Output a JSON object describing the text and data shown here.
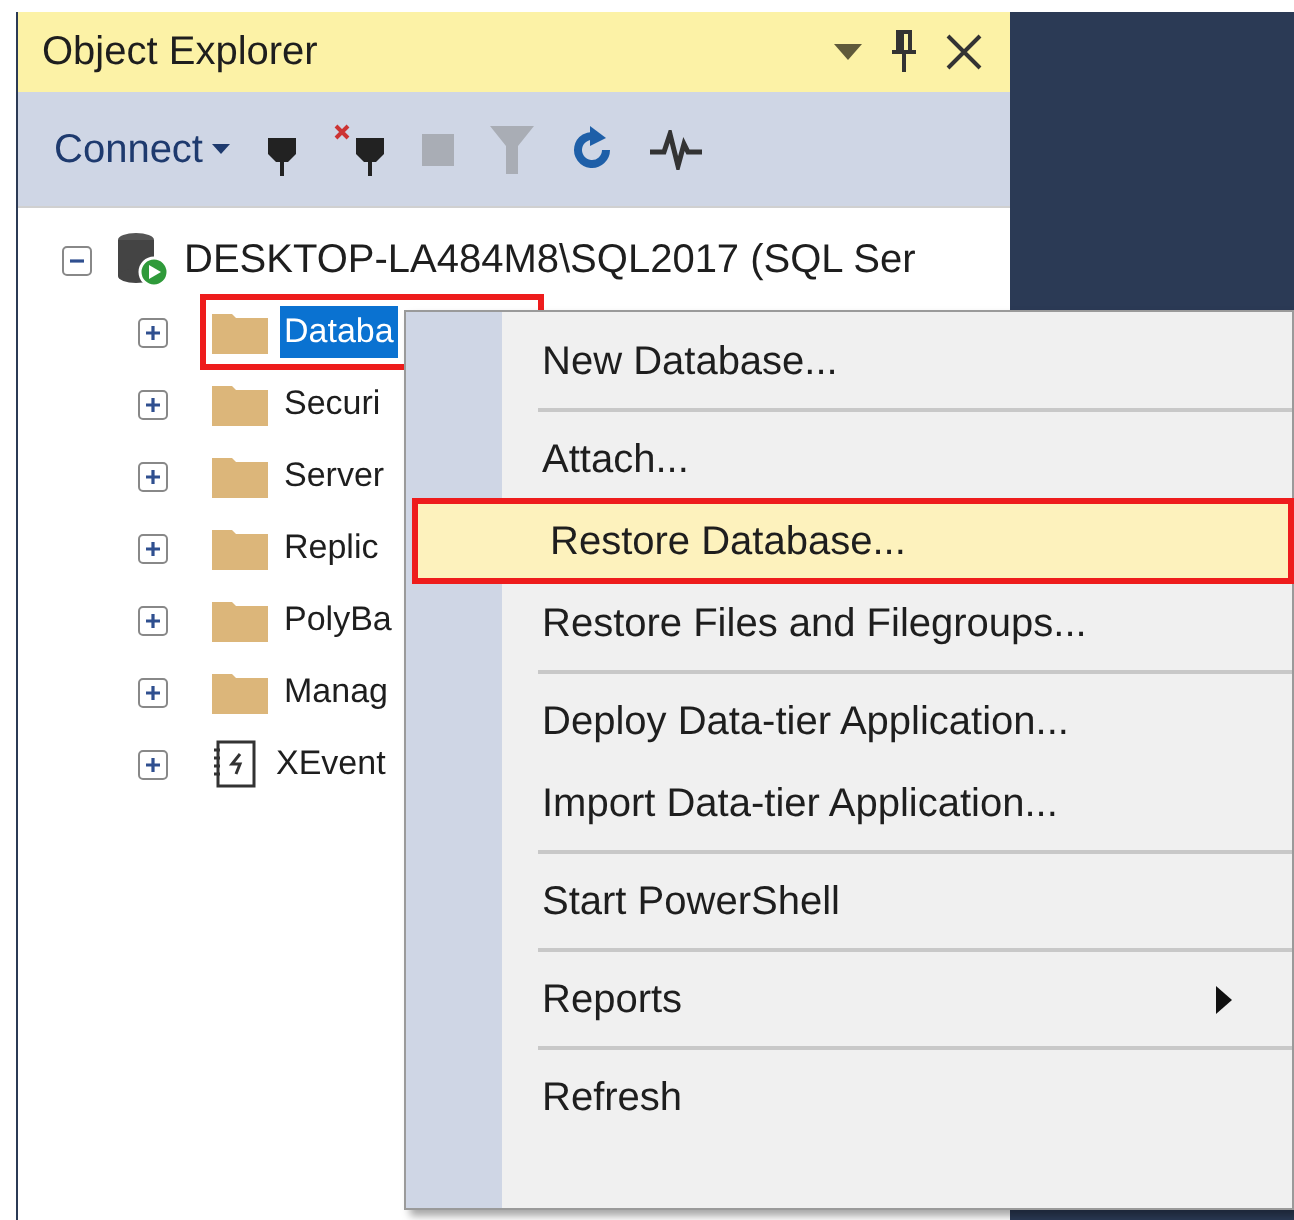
{
  "panel": {
    "title": "Object Explorer"
  },
  "toolbar": {
    "connect": "Connect"
  },
  "tree": {
    "server": {
      "label": "DESKTOP-LA484M8\\SQL2017 (SQL Ser",
      "expanded": true
    },
    "children": [
      {
        "kind": "folder",
        "label": "Databa",
        "selected": true,
        "annotated": true
      },
      {
        "kind": "folder",
        "label": "Securi",
        "selected": false,
        "annotated": false
      },
      {
        "kind": "folder",
        "label": "Server",
        "selected": false,
        "annotated": false
      },
      {
        "kind": "folder",
        "label": "Replic",
        "selected": false,
        "annotated": false
      },
      {
        "kind": "folder",
        "label": "PolyBa",
        "selected": false,
        "annotated": false
      },
      {
        "kind": "folder",
        "label": "Manag",
        "selected": false,
        "annotated": false
      },
      {
        "kind": "xevent",
        "label": "XEvent",
        "selected": false,
        "annotated": false
      }
    ]
  },
  "context_menu": [
    {
      "kind": "item",
      "label": "New Database...",
      "selected": false,
      "annotated": false
    },
    {
      "kind": "separator"
    },
    {
      "kind": "item",
      "label": "Attach...",
      "selected": false,
      "annotated": false
    },
    {
      "kind": "item",
      "label": "Restore Database...",
      "selected": true,
      "annotated": true
    },
    {
      "kind": "item",
      "label": "Restore Files and Filegroups...",
      "selected": false,
      "annotated": false
    },
    {
      "kind": "separator"
    },
    {
      "kind": "item",
      "label": "Deploy Data-tier Application...",
      "selected": false,
      "annotated": false
    },
    {
      "kind": "item",
      "label": "Import Data-tier Application...",
      "selected": false,
      "annotated": false
    },
    {
      "kind": "separator"
    },
    {
      "kind": "item",
      "label": "Start PowerShell",
      "selected": false,
      "annotated": false
    },
    {
      "kind": "separator"
    },
    {
      "kind": "submenu",
      "label": "Reports",
      "selected": false,
      "annotated": false
    },
    {
      "kind": "separator"
    },
    {
      "kind": "item",
      "label": "Refresh",
      "selected": false,
      "annotated": false
    }
  ]
}
